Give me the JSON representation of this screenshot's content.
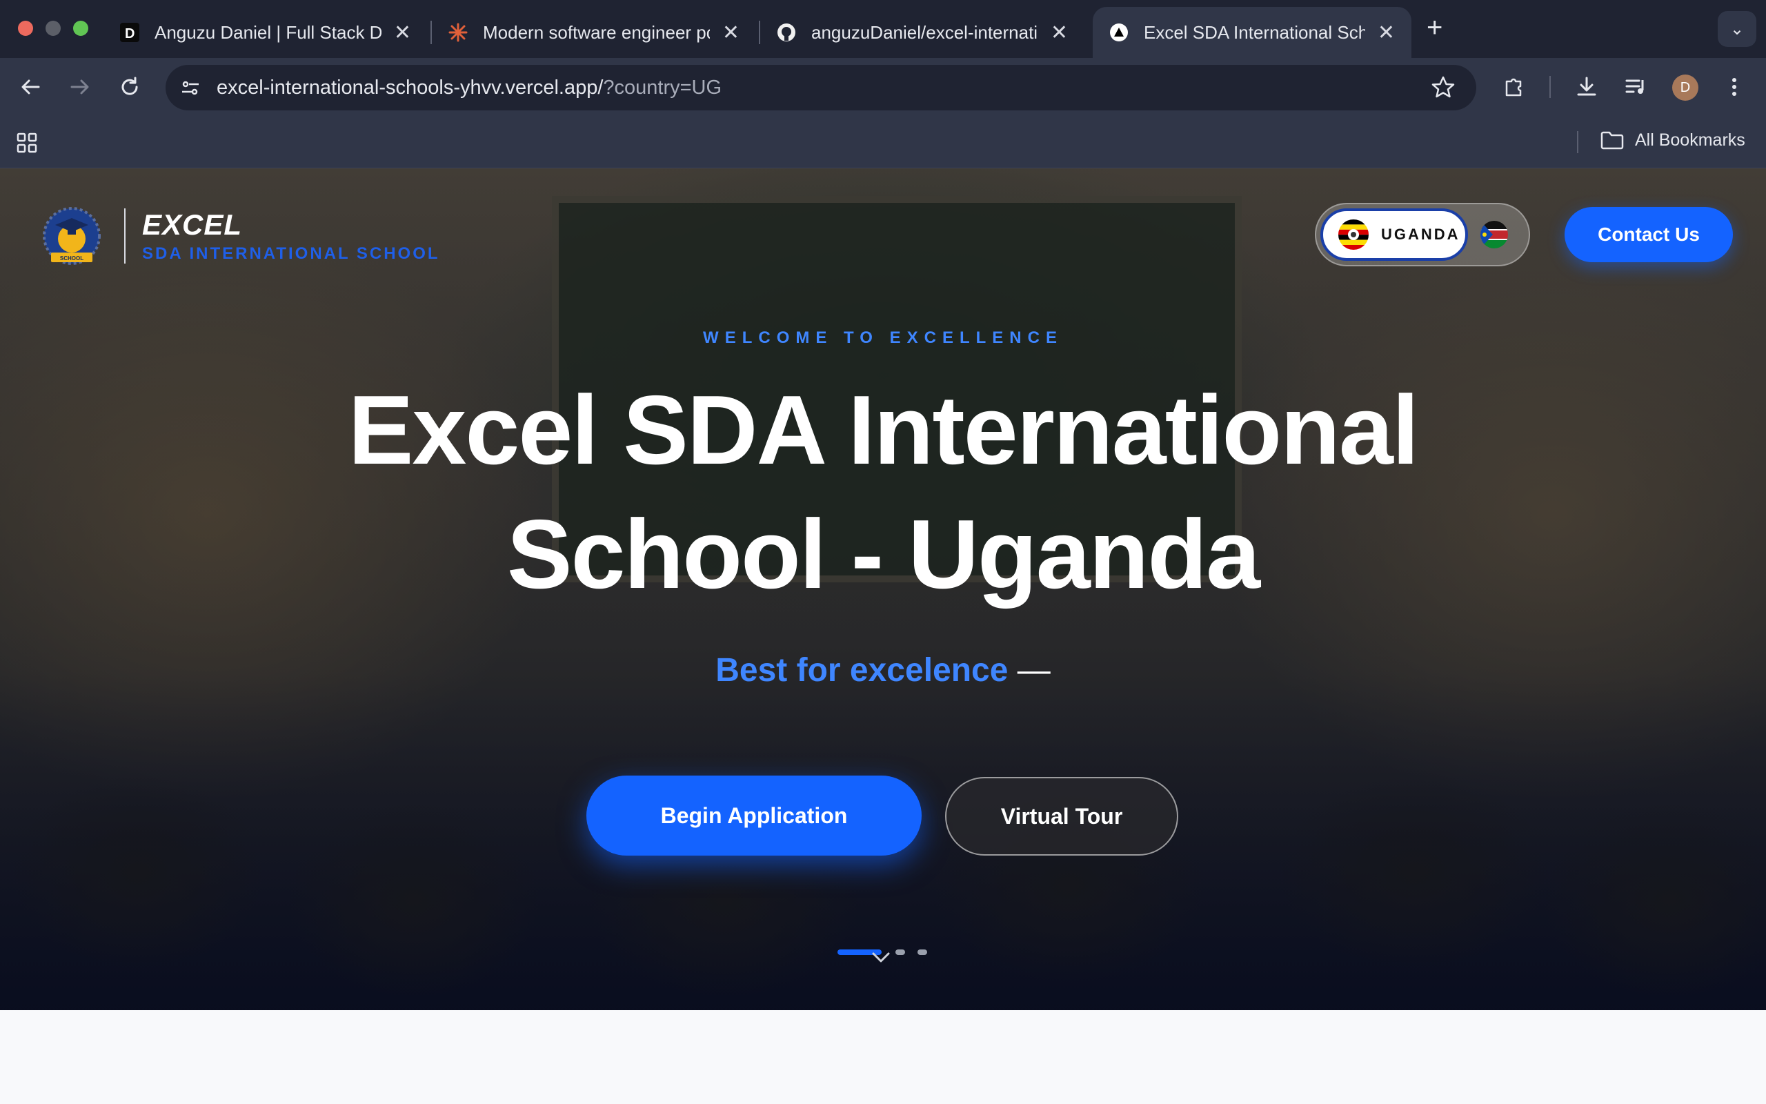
{
  "browser": {
    "tabs": [
      {
        "title": "Anguzu Daniel | Full Stack Developer",
        "active": false
      },
      {
        "title": "Modern software engineer portfolio",
        "active": false
      },
      {
        "title": "anguzuDaniel/excel-international-schools",
        "active": false
      },
      {
        "title": "Excel SDA International School",
        "active": true
      }
    ],
    "url_host": "excel-international-schools-yhvv.vercel.app/",
    "url_query": "?country=UG",
    "bookmarks_label": "All Bookmarks",
    "profile_initial": "D"
  },
  "site": {
    "brand_title": "EXCEL",
    "brand_subtitle": "SDA INTERNATIONAL SCHOOL",
    "logo_text": "SCHOOL",
    "country_label": "UGANDA",
    "contact_label": "Contact Us",
    "eyebrow": "WELCOME TO EXCELLENCE",
    "headline_line1": "Excel SDA International",
    "headline_line2": "School - Uganda",
    "tagline": "Best for excelence",
    "tagline_dash": "—",
    "primary_cta": "Begin Application",
    "secondary_cta": "Virtual Tour",
    "slide_indicator": {
      "active_index": 0,
      "count": 3
    }
  },
  "colors": {
    "accent": "#1463ff",
    "accent_text": "#3f86ff",
    "browser_bg": "#1f2332",
    "browser_toolbar": "#303648"
  }
}
